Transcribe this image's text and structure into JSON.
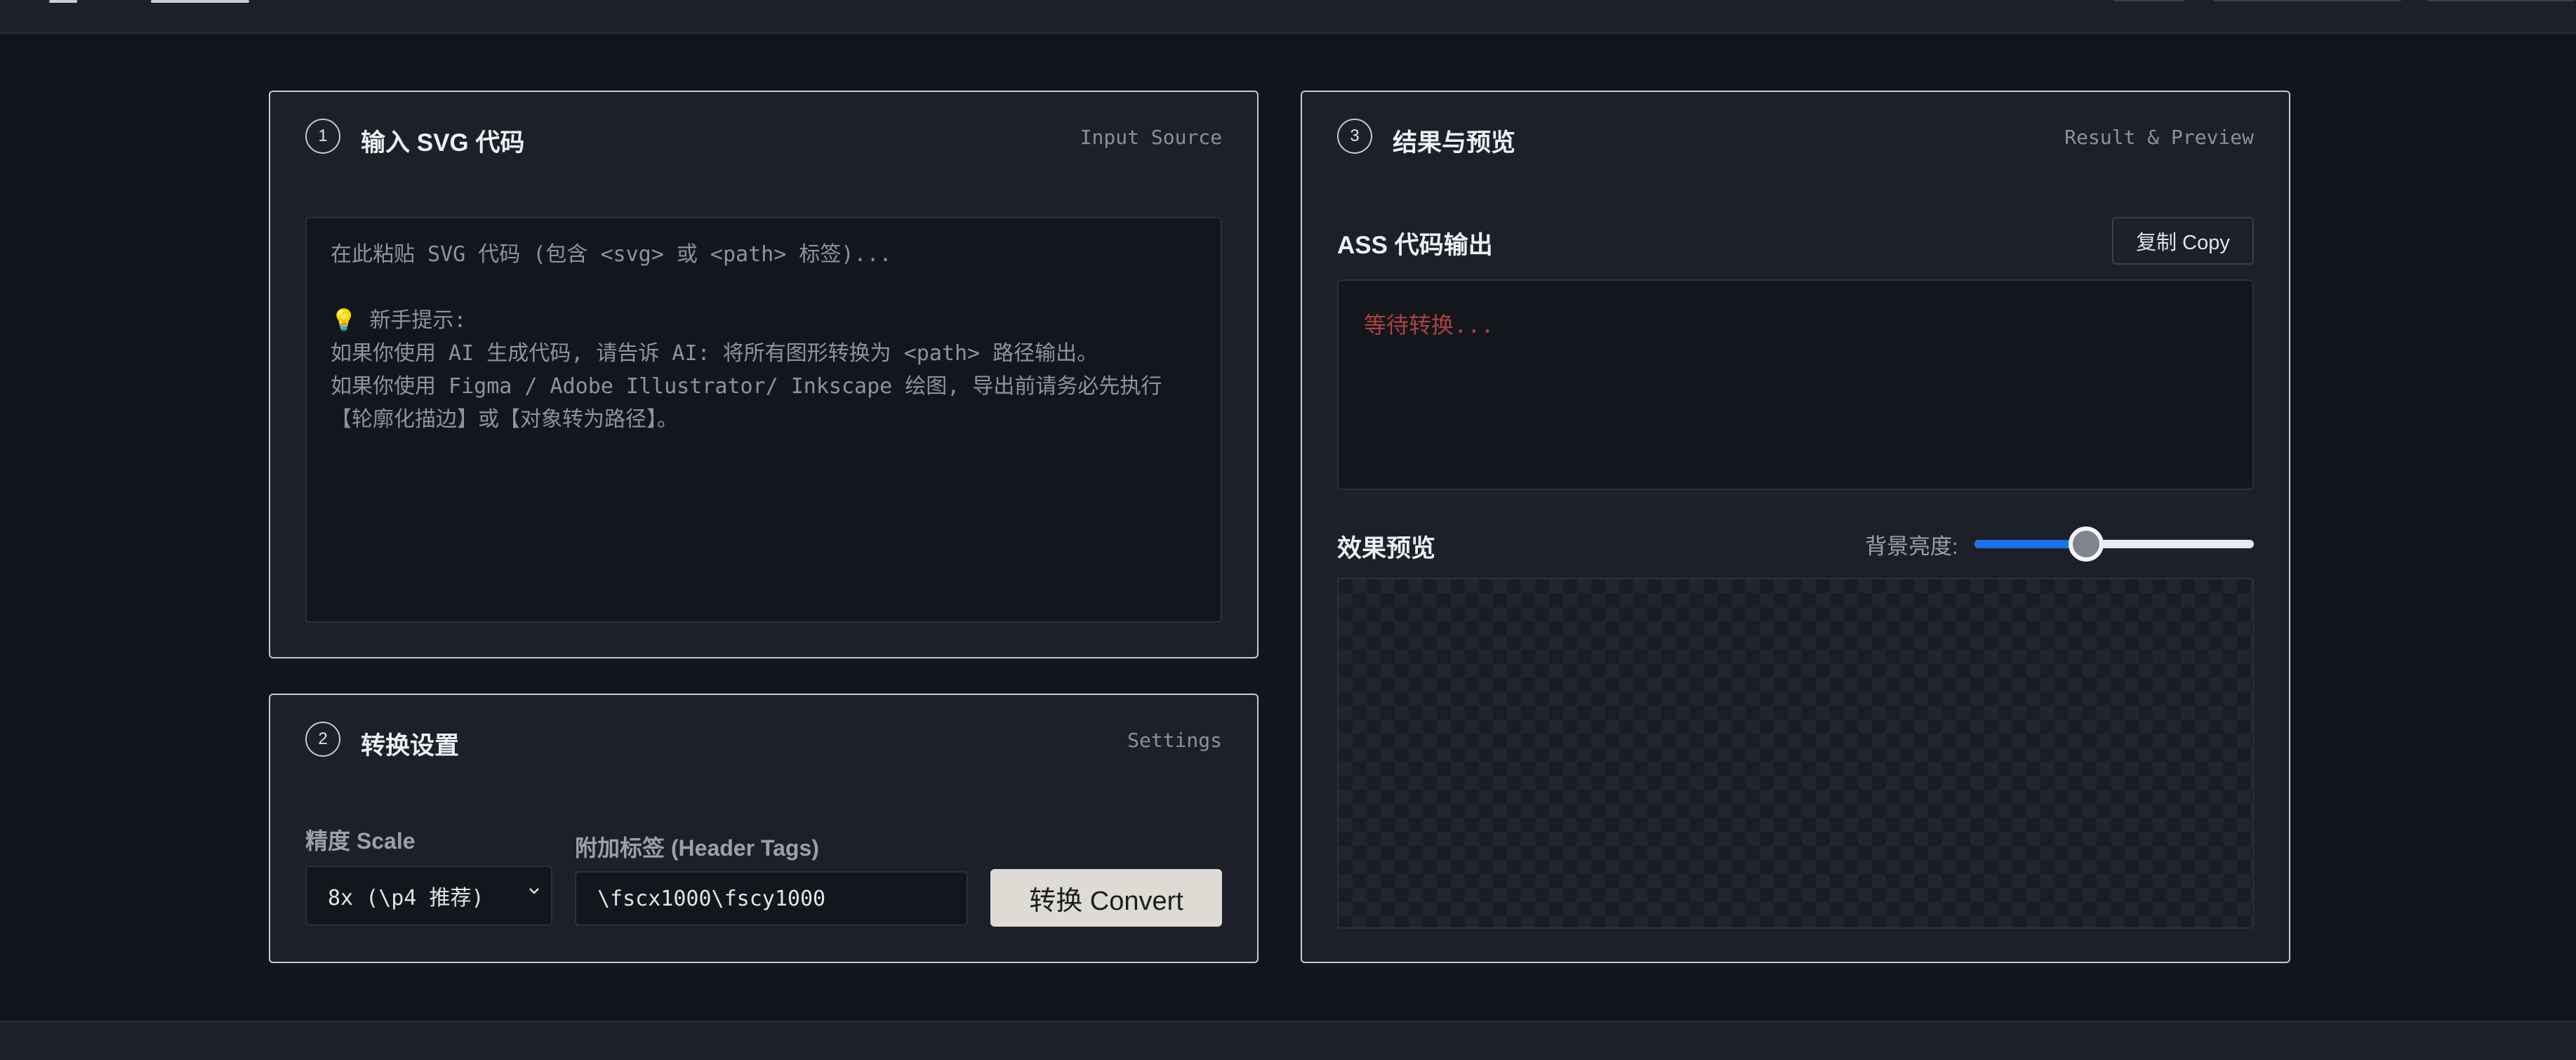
{
  "input_panel": {
    "step": "1",
    "title": "输入 SVG 代码",
    "subtitle": "Input Source",
    "placeholder": "在此粘贴 SVG 代码 (包含 <svg> 或 <path> 标签)...\n\n💡 新手提示:\n如果你使用 AI 生成代码, 请告诉 AI: 将所有图形转换为 <path> 路径输出。\n如果你使用 Figma / Adobe Illustrator/ Inkscape 绘图, 导出前请务必先执行\n【轮廓化描边】或【对象转为路径】。",
    "tip_icon": "lightbulb-icon"
  },
  "settings_panel": {
    "step": "2",
    "title": "转换设置",
    "subtitle": "Settings",
    "scale_label": "精度 Scale",
    "scale_value": "8x (\\p4 推荐)",
    "header_label": "附加标签 (Header Tags)",
    "header_value": "\\fscx1000\\fscy1000",
    "convert_label": "转换 Convert"
  },
  "result_panel": {
    "step": "3",
    "title": "结果与预览",
    "subtitle": "Result & Preview",
    "output_label": "ASS 代码输出",
    "copy_label": "复制 Copy",
    "output_placeholder": "等待转换...",
    "preview_label": "效果预览",
    "brightness_label": "背景亮度:",
    "brightness_value": 0.4
  },
  "colors": {
    "accent": "#1f6fe5",
    "convert_button": "#dddbd3",
    "placeholder_red": "#a9433f"
  }
}
